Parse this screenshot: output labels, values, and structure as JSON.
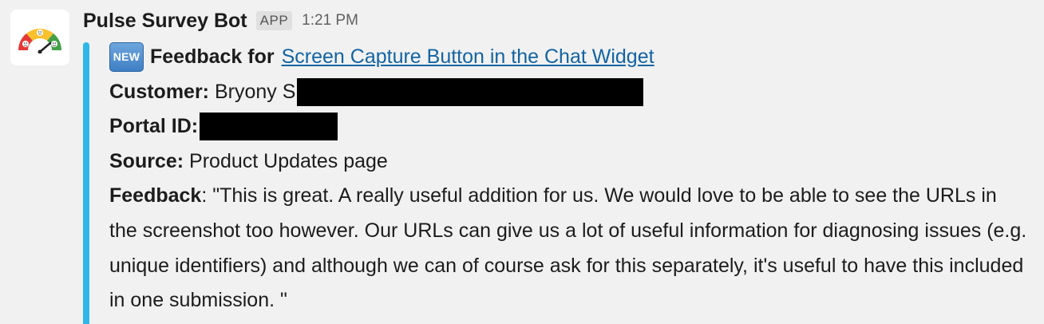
{
  "message": {
    "bot_name": "Pulse Survey Bot",
    "app_badge": "APP",
    "timestamp": "1:21 PM",
    "avatar_icon": "survey-gauge-faces-icon",
    "accent_color": "#2eb6e8",
    "new_badge": "NEW",
    "title_prefix": "Feedback for",
    "title_link": "Screen Capture Button in the Chat Widget",
    "customer_label": "Customer:",
    "customer_value": "Bryony S",
    "portal_label": "Portal ID:",
    "source_label": "Source:",
    "source_value": "Product Updates page",
    "feedback_label": "Feedback",
    "feedback_value": ": \"This is great. A really useful addition for us. We would love to be able to see the URLs in the screenshot too however. Our URLs can give us a lot of useful information for diagnosing issues (e.g. unique identifiers) and although we can of course ask for this separately, it's useful to have this included in one submission. \""
  }
}
